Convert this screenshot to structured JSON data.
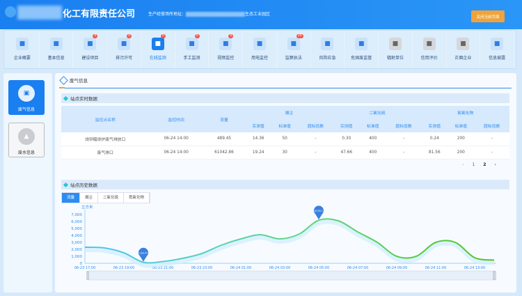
{
  "header": {
    "title": "化工有限责任公司",
    "address_label": "生产经营场所地址：",
    "address_suffix": "生态工业园区",
    "close_button": "关闭当前页面"
  },
  "nav": [
    {
      "label": "企业概要",
      "icon": "building-icon"
    },
    {
      "label": "基本信息",
      "icon": "info-icon"
    },
    {
      "label": "建设项目",
      "icon": "project-icon",
      "badge": "0"
    },
    {
      "label": "排污许可",
      "icon": "permit-icon",
      "badge": "0"
    },
    {
      "label": "在线监测",
      "icon": "monitor-icon",
      "badge": "0",
      "active": true
    },
    {
      "label": "手工监测",
      "icon": "manual-icon",
      "badge": "0"
    },
    {
      "label": "视频监控",
      "icon": "camera-icon",
      "badge": "0"
    },
    {
      "label": "用电监控",
      "icon": "power-icon"
    },
    {
      "label": "监察执法",
      "icon": "inspect-icon",
      "badge": "24"
    },
    {
      "label": "风险应急",
      "icon": "risk-icon"
    },
    {
      "label": "危固废监管",
      "icon": "waste-icon"
    },
    {
      "label": "辐射单位",
      "icon": "radiation-icon",
      "gray": true
    },
    {
      "label": "信用评价",
      "icon": "credit-icon",
      "gray": true
    },
    {
      "label": "正面企业",
      "icon": "positive-icon",
      "gray": true
    },
    {
      "label": "信息披露",
      "icon": "disclosure-icon"
    }
  ],
  "sidebar": [
    {
      "label": "废气信息",
      "active": true
    },
    {
      "label": "废水信息"
    }
  ],
  "main_tab": "废气信息",
  "realtime": {
    "title": "站点实时数据",
    "headers": {
      "name": "监控点名称",
      "time": "监控时间",
      "flow": "流量",
      "groups": [
        "烟尘",
        "二氧化硫",
        "氮氧化物"
      ],
      "sub": [
        "实测值",
        "标准值",
        "超标倍数"
      ]
    },
    "rows": [
      [
        "烧钚醋烧炉废气排放口",
        "06-24 14:00",
        "489.45",
        "14.36",
        "50",
        "-",
        "0.30",
        "400",
        "-",
        "0.24",
        "200",
        "-"
      ],
      [
        "废气排口",
        "06-24 14:00",
        "61042.86",
        "19.24",
        "30",
        "-",
        "47.66",
        "400",
        "-",
        "81.56",
        "200",
        "-"
      ]
    ],
    "pager": {
      "prev": "‹",
      "pages": [
        "1",
        "2"
      ],
      "current": "2",
      "next": "›"
    }
  },
  "history": {
    "title": "站点历史数据",
    "tabs": [
      "流量",
      "烟尘",
      "二氧化硫",
      "氮氧化物"
    ],
    "active_tab": "流量"
  },
  "chart_data": {
    "type": "line",
    "unit": "立方米",
    "ylim": [
      0,
      7000
    ],
    "yticks": [
      "0",
      "1,000",
      "2,000",
      "3,000",
      "4,000",
      "5,000",
      "6,000",
      "7,000"
    ],
    "xticks": [
      "06-23 17:00",
      "06-23 19:00",
      "06-23 21:00",
      "06-23 23:00",
      "06-24 01:00",
      "06-24 03:00",
      "06-24 05:00",
      "06-24 07:00",
      "06-24 09:00",
      "06-24 11:00",
      "06-24 13:00"
    ],
    "x": [
      "17:00",
      "18:00",
      "19:00",
      "20:00",
      "21:00",
      "22:00",
      "23:00",
      "00:00",
      "01:00",
      "02:00",
      "03:00",
      "04:00",
      "05:00",
      "06:00",
      "07:00",
      "08:00",
      "09:00",
      "10:00",
      "11:00",
      "12:00",
      "13:00",
      "14:00"
    ],
    "values": [
      2300,
      2200,
      1500,
      136.47,
      250,
      700,
      1400,
      2600,
      3500,
      4100,
      3500,
      4200,
      6178.1,
      6100,
      4500,
      3000,
      1000,
      1000,
      3000,
      3000,
      800,
      450
    ],
    "markers": [
      {
        "label": "136.47",
        "type": "min"
      },
      {
        "label": "6178.1",
        "type": "max"
      }
    ],
    "colors": [
      "#4fc3f7",
      "#5fd88a",
      "#52c41a"
    ]
  }
}
